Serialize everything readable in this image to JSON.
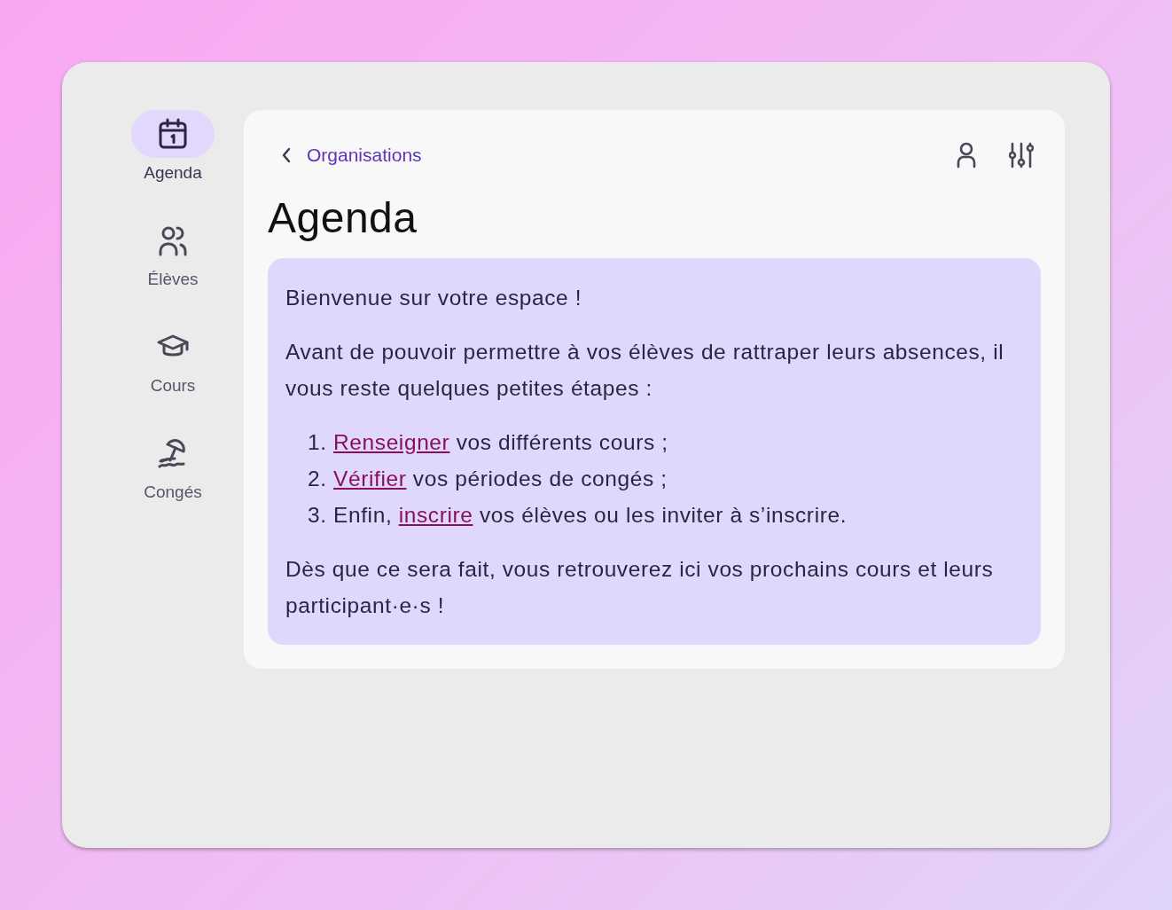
{
  "sidebar": {
    "items": [
      {
        "label": "Agenda",
        "kind": "calendar",
        "selected": true
      },
      {
        "label": "Élèves",
        "kind": "users",
        "selected": false
      },
      {
        "label": "Cours",
        "kind": "cap",
        "selected": false
      },
      {
        "label": "Congés",
        "kind": "beach",
        "selected": false
      }
    ]
  },
  "header": {
    "back_link": "Organisations"
  },
  "title": "Agenda",
  "notice": {
    "greeting": "Bienvenue sur votre espace !",
    "intro": "Avant de pouvoir permettre à vos élèves de rattraper leurs absences, il vous reste quelques petites étapes :",
    "steps": [
      {
        "number": "1.",
        "link": "Renseigner",
        "after": " vos différents cours ;"
      },
      {
        "number": "2.",
        "link": "Vérifier",
        "after": " vos périodes de congés ;"
      },
      {
        "number": "3.",
        "before": "Enfin, ",
        "link": "inscrire",
        "after": " vos élèves ou les inviter à s’inscrire."
      }
    ],
    "outro": "Dès que ce sera fait, vous retrouverez ici vos prochains cours et leurs participant·e·s !"
  }
}
